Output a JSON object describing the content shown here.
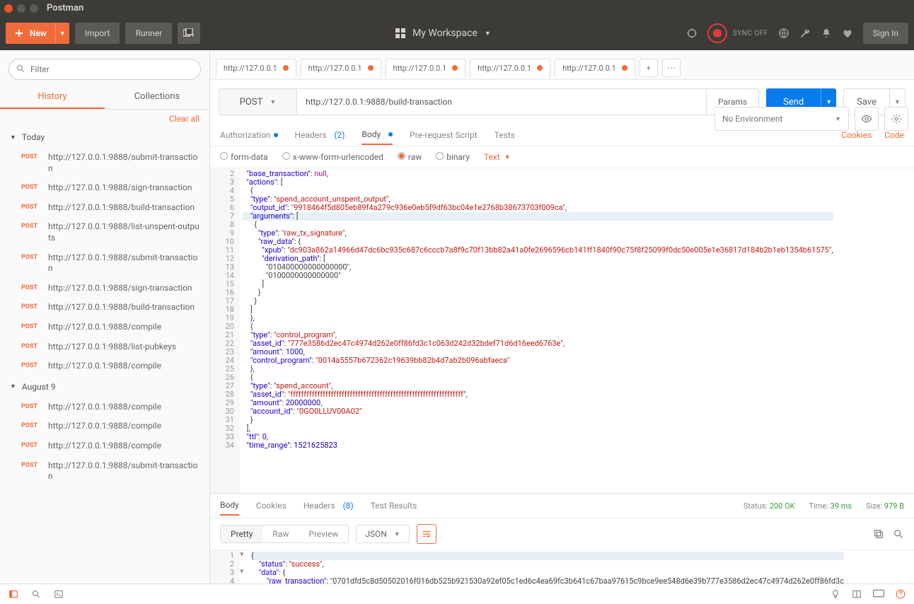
{
  "window_title": "Postman",
  "toolbar": {
    "new_label": "New",
    "import_label": "Import",
    "runner_label": "Runner",
    "workspace_label": "My Workspace",
    "sync_label": "SYNC OFF",
    "signin_label": "Sign In"
  },
  "sidebar": {
    "filter_placeholder": "Filter",
    "tabs": {
      "history": "History",
      "collections": "Collections"
    },
    "clear_all": "Clear all",
    "sections": [
      {
        "label": "Today",
        "items": [
          {
            "method": "POST",
            "url": "http://127.0.0.1:9888/submit-transaction"
          },
          {
            "method": "POST",
            "url": "http://127.0.0.1:9888/sign-transaction"
          },
          {
            "method": "POST",
            "url": "http://127.0.0.1:9888/build-transaction"
          },
          {
            "method": "POST",
            "url": "http://127.0.0.1:9888/list-unspent-outputs"
          },
          {
            "method": "POST",
            "url": "http://127.0.0.1:9888/submit-transaction"
          },
          {
            "method": "POST",
            "url": "http://127.0.0.1:9888/sign-transaction"
          },
          {
            "method": "POST",
            "url": "http://127.0.0.1:9888/build-transaction"
          },
          {
            "method": "POST",
            "url": "http://127.0.0.1:9888/compile"
          },
          {
            "method": "POST",
            "url": "http://127.0.0.1:9888/list-pubkeys"
          },
          {
            "method": "POST",
            "url": "http://127.0.0.1:9888/compile"
          }
        ]
      },
      {
        "label": "August 9",
        "items": [
          {
            "method": "POST",
            "url": "http://127.0.0.1:9888/compile"
          },
          {
            "method": "POST",
            "url": "http://127.0.0.1:9888/compile"
          },
          {
            "method": "POST",
            "url": "http://127.0.0.1:9888/compile"
          },
          {
            "method": "POST",
            "url": "http://127.0.0.1:9888/submit-transaction"
          }
        ]
      }
    ]
  },
  "request_tabs": [
    {
      "label": "http://127.0.0.1"
    },
    {
      "label": "http://127.0.0.1"
    },
    {
      "label": "http://127.0.0.1"
    },
    {
      "label": "http://127.0.0.1"
    },
    {
      "label": "http://127.0.0.1"
    }
  ],
  "env": {
    "label": "No Environment"
  },
  "request": {
    "method": "POST",
    "url": "http://127.0.0.1:9888/build-transaction",
    "params_btn": "Params",
    "send_btn": "Send",
    "save_btn": "Save"
  },
  "subtabs": {
    "auth": "Authorization",
    "headers": "Headers",
    "headers_count": "(2)",
    "body": "Body",
    "prereq": "Pre-request Script",
    "tests": "Tests",
    "cookies": "Cookies",
    "code": "Code"
  },
  "body_opts": {
    "form": "form-data",
    "xwww": "x-www-form-urlencoded",
    "raw": "raw",
    "binary": "binary",
    "type": "Text"
  },
  "editor": {
    "start": 2,
    "lines": [
      "  \"base_transaction\": null,",
      "  \"actions\": [",
      "    {",
      "    \"type\": \"spend_account_unspent_output\",",
      "    \"output_id\": \"9918464f5d805eb89f4a279c936e0eb5f9df63bc04e1e2768b38673703f009ca\",",
      "    \"arguments\": [",
      "      {",
      "        \"type\": \"raw_tx_signature\",",
      "        \"raw_data\": {",
      "          \"xpub\": \"dc903a862a14966d47dc6bc935c687c6cccb7a8f9c70f13bb82a41a0fe2696596cb141ff1840f90c75f8f25099f0dc50e005e1e36817d184b2b1eb1354b61575\",",
      "          \"derivation_path\": [",
      "            \"010400000000000000\",",
      "            \"0100000000000000\"",
      "          ]",
      "        }",
      "      }",
      "    ]",
      "    },",
      "    {",
      "    \"type\": \"control_program\",",
      "    \"asset_id\": \"777e3586d2ec47c4974d262e0ff86fd3c1c063d242d32bdef71d6d16eed6763e\",",
      "    \"amount\": 1000,",
      "    \"control_program\": \"0014a5557b672362c19639bb82b4d7ab2b096abfaeca\"",
      "    },",
      "    {",
      "    \"type\": \"spend_account\",",
      "    \"asset_id\": \"ffffffffffffffffffffffffffffffffffffffffffffffffffffffffffffffff\",",
      "    \"amount\": 20000000,",
      "    \"account_id\": \"0GO0LLUV00A02\"",
      "    }",
      "  ],",
      "  \"ttl\": 0,",
      "  \"time_range\": 1521625823"
    ],
    "highlight_line": 7
  },
  "response": {
    "tabs": {
      "body": "Body",
      "cookies": "Cookies",
      "headers": "Headers",
      "headers_count": "(8)",
      "tests": "Test Results"
    },
    "status": {
      "label": "Status:",
      "value": "200 OK",
      "time_label": "Time:",
      "time": "39 ms",
      "size_label": "Size:",
      "size": "979 B"
    },
    "toolbar": {
      "pretty": "Pretty",
      "raw": "Raw",
      "preview": "Preview",
      "type": "JSON"
    },
    "lines": [
      "{",
      "    \"status\": \"success\",",
      "    \"data\": {",
      "        \"raw_transaction\": \"0701dfd5c8d50502016f016db525b921530a92ef05c1ed6c4ea69fc3b641c67baa97615c9bce9ee548d6e39b777e3586d2ec47c4974d262e0ff86fd3c"
    ]
  }
}
